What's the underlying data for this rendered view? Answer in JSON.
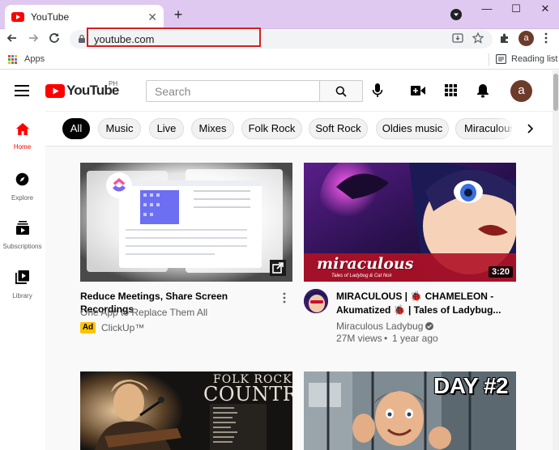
{
  "browser": {
    "tab_title": "YouTube",
    "url": "youtube.com",
    "bookmarks": {
      "apps_label": "Apps",
      "reading_list_label": "Reading list"
    },
    "avatar_letter": "a",
    "frame_color": "#e0c9f0"
  },
  "youtube": {
    "logo_text": "YouTube",
    "region": "PH",
    "search_placeholder": "Search",
    "avatar_letter": "a",
    "brand_color": "#ff0000",
    "sidebar": [
      {
        "label": "Home",
        "icon": "home-icon",
        "active": true
      },
      {
        "label": "Explore",
        "icon": "compass-icon",
        "active": false
      },
      {
        "label": "Subscriptions",
        "icon": "subscriptions-icon",
        "active": false
      },
      {
        "label": "Library",
        "icon": "library-icon",
        "active": false
      }
    ],
    "chips": [
      "All",
      "Music",
      "Live",
      "Mixes",
      "Folk Rock",
      "Soft Rock",
      "Oldies music",
      "Miraculous"
    ],
    "videos": [
      {
        "title": "Reduce Meetings, Share Screen Recordings",
        "subtitle": "One App to Replace Them All",
        "ad_badge": "Ad",
        "advertiser": "ClickUp™"
      },
      {
        "title_line1": "MIRACULOUS | 🐞 CHAMELEON -",
        "title_line2": "Akumatized 🐞 | Tales of Ladybug...",
        "channel": "Miraculous Ladybug",
        "views": "27M views",
        "age": "1 year ago",
        "duration": "3:20",
        "thumb_logo": "miraculous",
        "thumb_tagline": "Tales of Ladybug & Cat Noir"
      },
      {
        "thumb_text_1": "FOLK ROCK",
        "thumb_text_2": "COUNTRY"
      },
      {
        "thumb_text": "DAY #2"
      }
    ]
  }
}
